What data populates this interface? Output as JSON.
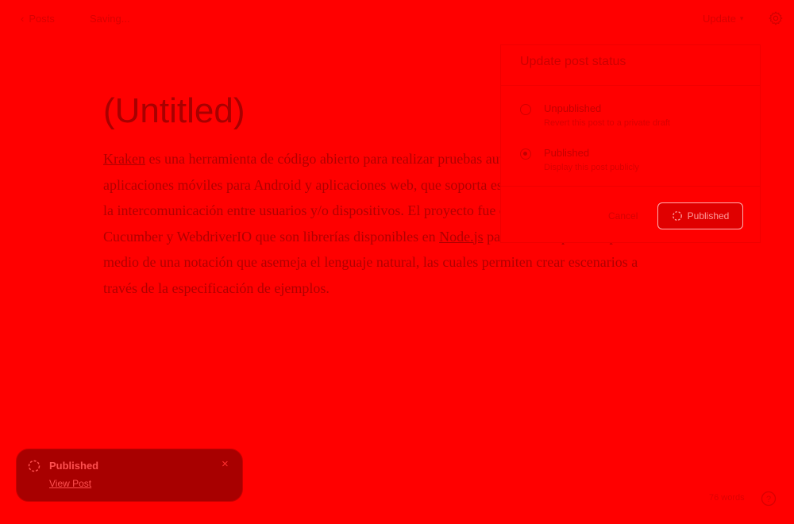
{
  "topbar": {
    "back_label": "Posts",
    "status_text": "Saving...",
    "update_label": "Update",
    "settings_icon": "gear-icon"
  },
  "editor": {
    "title": "(Untitled)",
    "body": {
      "link1": "Kraken",
      "text1": " es una herramienta de código abierto para realizar pruebas automatizadas del tipo E2E con aplicaciones móviles para Android y aplicaciones web, que soporta escenarios donde es requerida la intercomunicación entre usuarios y/o dispositivos. El proyecto fue desarrollado haciendo uso de Cucumber y WebdriverIO que son librerías disponibles en ",
      "link2": "Node.js",
      "text2": " para realizar pruebas por medio de una notación que asemeja el lenguaje natural, las cuales permiten crear escenarios a través de la especificación de ejemplos."
    }
  },
  "status_popover": {
    "title": "Update post status",
    "options": [
      {
        "label": "Unpublished",
        "description": "Revert this post to a private draft",
        "checked": false
      },
      {
        "label": "Published",
        "description": "Display this post publicly",
        "checked": true
      }
    ],
    "cancel_label": "Cancel",
    "confirm_label": "Published"
  },
  "toast": {
    "title": "Published",
    "link_label": "View Post",
    "close_icon": "close-icon"
  },
  "footer": {
    "word_count": "76 words",
    "help_icon": "help-icon"
  },
  "colors": {
    "background": "#ff0000",
    "toast_bg": "#a80000"
  }
}
